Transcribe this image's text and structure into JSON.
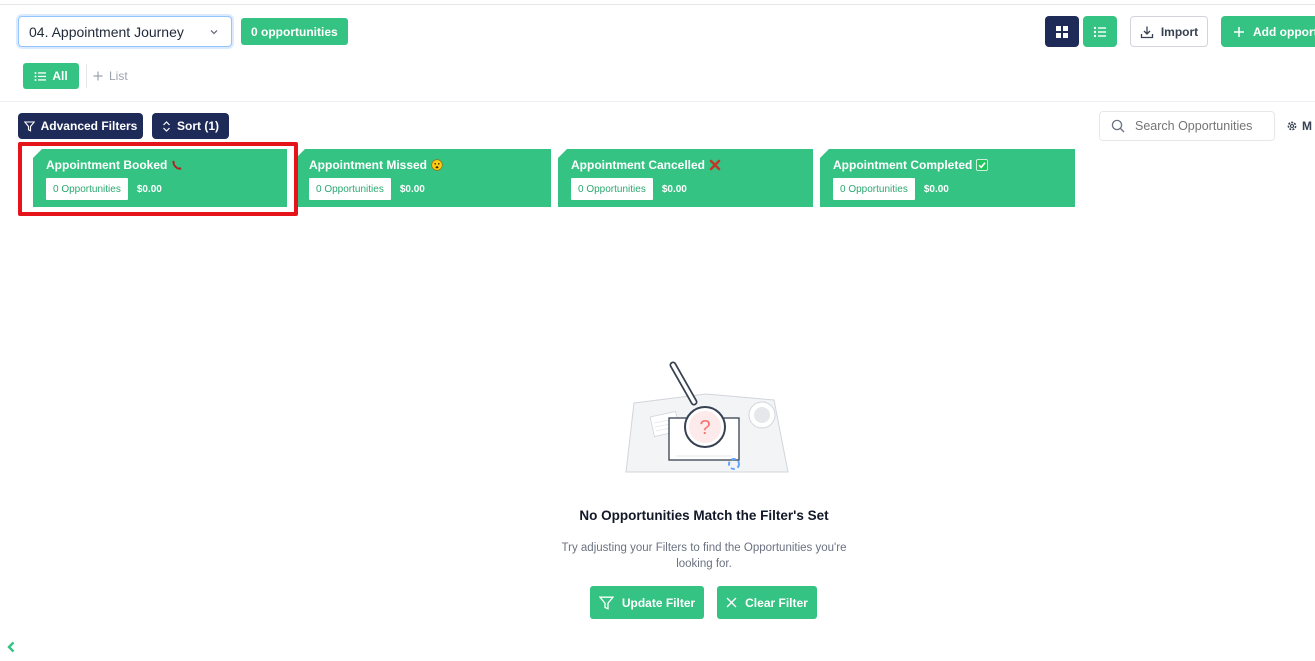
{
  "header": {
    "pipeline_select": "04. Appointment Journey",
    "opportunity_count": "0 opportunities",
    "import_label": "Import",
    "add_label": "Add opport"
  },
  "tabs": {
    "all_label": "All",
    "add_list_label": "List"
  },
  "toolbar": {
    "filter_label": "Advanced Filters",
    "sort_label": "Sort (1)",
    "search_placeholder": "Search Opportunities",
    "manage_label": "M"
  },
  "stages": [
    {
      "title": "Appointment Booked",
      "emoji": "phone-emoji",
      "count": "0 Opportunities",
      "value": "$0.00"
    },
    {
      "title": "Appointment Missed",
      "emoji": "face-emoji",
      "count": "0 Opportunities",
      "value": "$0.00"
    },
    {
      "title": "Appointment Cancelled",
      "emoji": "cross-mark-emoji",
      "count": "0 Opportunities",
      "value": "$0.00"
    },
    {
      "title": "Appointment Completed",
      "emoji": "check-box-emoji",
      "count": "0 Opportunities",
      "value": "$0.00"
    }
  ],
  "empty_state": {
    "title": "No Opportunities Match the Filter's Set",
    "description": "Try adjusting your Filters to find the Opportunities you're looking for.",
    "update_label": "Update Filter",
    "clear_label": "Clear Filter"
  },
  "colors": {
    "brand_green": "#34c382",
    "navy": "#1e2a57",
    "highlight_red": "#e5141a"
  }
}
